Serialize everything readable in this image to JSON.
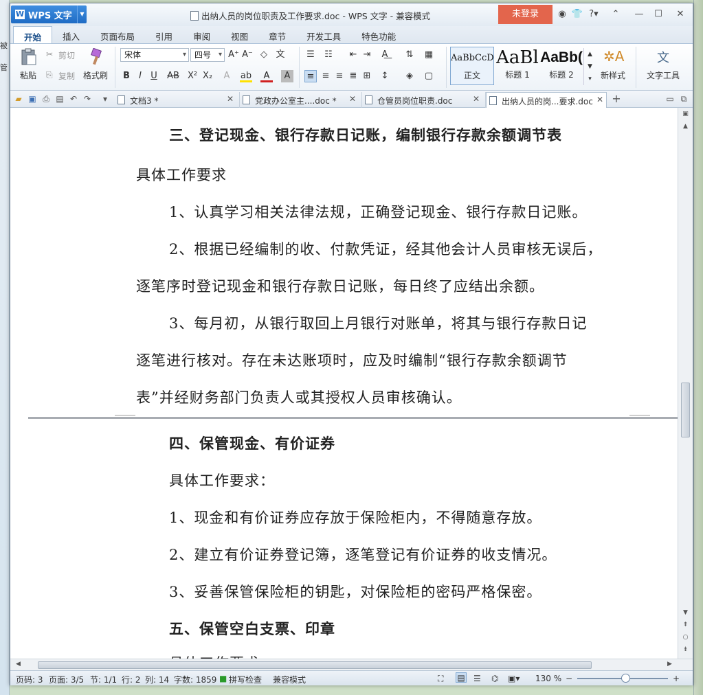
{
  "window": {
    "app_name": "WPS 文字",
    "title": "出纳人员的岗位职责及工作要求.doc - WPS 文字 - 兼容模式",
    "login_label": "未登录"
  },
  "background_left": [
    "被",
    "管"
  ],
  "ribbon_tabs": [
    "开始",
    "插入",
    "页面布局",
    "引用",
    "审阅",
    "视图",
    "章节",
    "开发工具",
    "特色功能"
  ],
  "ribbon": {
    "paste": "粘贴",
    "cut": "剪切",
    "copy": "复制",
    "format_painter": "格式刷",
    "font_name": "宋体",
    "font_size": "四号",
    "styles": [
      {
        "sample": "AaBbCcD",
        "label": "正文"
      },
      {
        "sample": "AaBl",
        "label": "标题 1"
      },
      {
        "sample": "AaBb(",
        "label": "标题 2"
      }
    ],
    "new_style": "新样式",
    "text_tools": "文字工具"
  },
  "doc_tabs": [
    {
      "label": "文档3 *"
    },
    {
      "label": "党政办公室主....doc *"
    },
    {
      "label": "仓管员岗位职责.doc"
    },
    {
      "label": "出纳人员的岗...要求.doc"
    }
  ],
  "document": {
    "page1": [
      {
        "text": "三、登记现金、银行存款日记账，编制银行存款余额调节表",
        "heading": true
      },
      {
        "text": "具体工作要求"
      },
      {
        "text": "1、认真学习相关法律法规，正确登记现金、银行存款日记账。"
      },
      {
        "text": "2、根据已经编制的收、付款凭证，经其他会计人员审核无误后，"
      },
      {
        "text": "逐笔序时登记现金和银行存款日记账，每日终了应结出余额。"
      },
      {
        "text": "3、每月初，从银行取回上月银行对账单，将其与银行存款日记"
      },
      {
        "text": "逐笔进行核对。存在未达账项时，应及时编制“银行存款余额调节"
      },
      {
        "text": "表”并经财务部门负责人或其授权人员审核确认。"
      }
    ],
    "page2": [
      {
        "text": "四、保管现金、有价证券",
        "heading": true
      },
      {
        "text": "具体工作要求："
      },
      {
        "text": "1、现金和有价证券应存放于保险柜内，不得随意存放。"
      },
      {
        "text": "2、建立有价证券登记簿，逐笔登记有价证券的收支情况。"
      },
      {
        "text": "3、妥善保管保险柜的钥匙，对保险柜的密码严格保密。"
      },
      {
        "text": "五、保管空白支票、印章",
        "heading": true
      },
      {
        "text": "具体工作要求"
      }
    ]
  },
  "status": {
    "page_code": "页码: 3",
    "page": "页面: 3/5",
    "section": "节: 1/1",
    "row": "行: 2",
    "col": "列: 14",
    "word_count": "字数: 1859",
    "spell_check": "拼写检查",
    "compat_mode": "兼容模式",
    "zoom": "130 %"
  }
}
